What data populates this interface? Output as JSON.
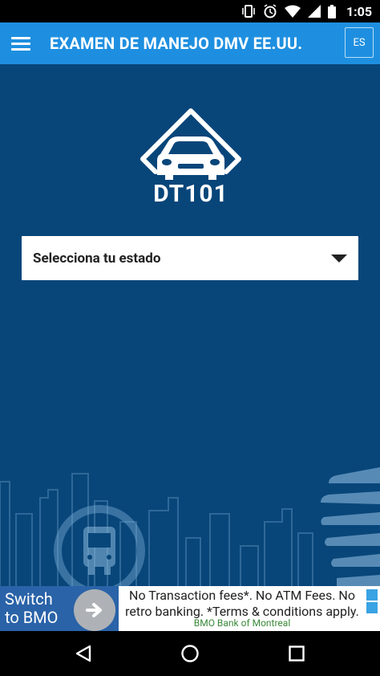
{
  "status_bar": {
    "time": "1:05",
    "icons": [
      "vibrate-icon",
      "alarm-icon",
      "wifi-icon",
      "signal-icon",
      "battery-icon"
    ]
  },
  "app_bar": {
    "title": "EXAMEN DE MANEJO DMV EE.UU.",
    "language_button": "ES",
    "menu_icon": "hamburger-menu-icon",
    "color": "#1e8fe0"
  },
  "main": {
    "background": "#08467a",
    "logo_text": "DT101",
    "state_select": {
      "placeholder": "Selecciona tu estado",
      "arrow_icon": "dropdown-arrow-icon"
    }
  },
  "ad": {
    "left_text": "Switch\nto BMO",
    "main_text": "No Transaction fees*. No ATM Fees. No retro banking. *Terms & conditions apply.",
    "sponsor": "BMO Bank of Montreal",
    "accent": "#2a63a8"
  },
  "nav_bar": {
    "buttons": [
      "back-icon",
      "home-icon",
      "recents-icon"
    ]
  }
}
